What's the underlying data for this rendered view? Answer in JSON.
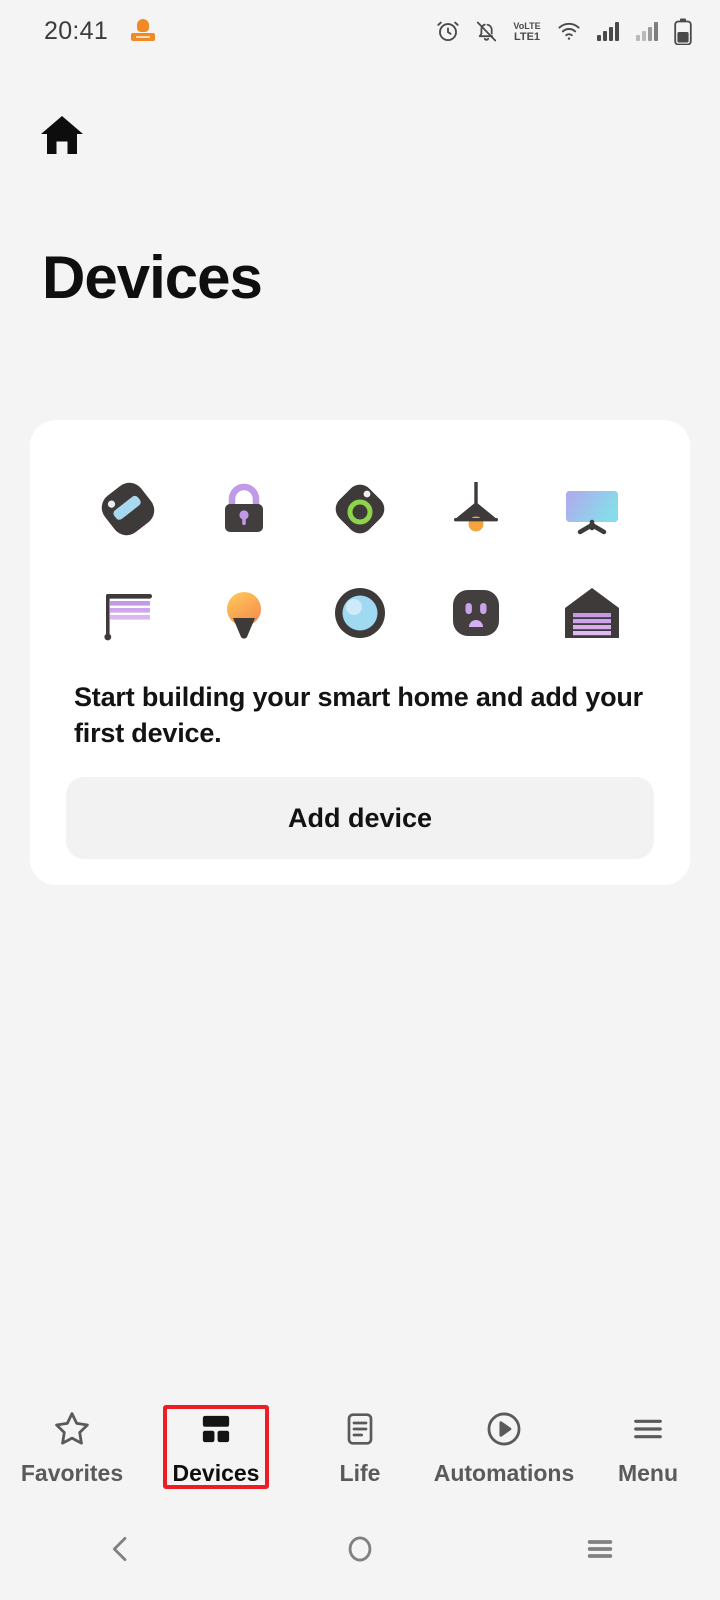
{
  "statusbar": {
    "time": "20:41",
    "left_icons": [
      {
        "name": "notification-badge-icon"
      }
    ],
    "right_icons": [
      {
        "name": "alarm-icon"
      },
      {
        "name": "notifications-muted-icon"
      },
      {
        "name": "volte-lte1-icon",
        "label_top": "VoLTE",
        "label_bottom": "LTE1"
      },
      {
        "name": "wifi-icon"
      },
      {
        "name": "signal-bars-sim1-icon"
      },
      {
        "name": "signal-bars-sim2-icon"
      },
      {
        "name": "battery-icon"
      }
    ]
  },
  "header": {
    "home_icon": "home-icon",
    "title": "Devices"
  },
  "empty_state": {
    "device_icons": [
      {
        "name": "robot-vacuum-icon",
        "label": "Robot vacuum"
      },
      {
        "name": "smart-lock-icon",
        "label": "Smart lock"
      },
      {
        "name": "sensor-icon",
        "label": "Sensor"
      },
      {
        "name": "pendant-light-icon",
        "label": "Pendant light"
      },
      {
        "name": "television-icon",
        "label": "Television"
      },
      {
        "name": "awning-icon",
        "label": "Awning"
      },
      {
        "name": "light-bulb-icon",
        "label": "Light bulb"
      },
      {
        "name": "motion-sensor-icon",
        "label": "Motion sensor"
      },
      {
        "name": "power-socket-icon",
        "label": "Power socket"
      },
      {
        "name": "garage-door-icon",
        "label": "Garage door"
      }
    ],
    "message": "Start building your smart home and add your first device.",
    "add_device_label": "Add device"
  },
  "tabbar": {
    "tabs": [
      {
        "label": "Favorites",
        "icon": "star-icon",
        "active": false
      },
      {
        "label": "Devices",
        "icon": "grid-icon",
        "active": true
      },
      {
        "label": "Life",
        "icon": "document-icon",
        "active": false
      },
      {
        "label": "Automations",
        "icon": "play-circle-icon",
        "active": false
      },
      {
        "label": "Menu",
        "icon": "hamburger-icon",
        "active": false
      }
    ],
    "highlight_color": "#ee1c25"
  },
  "navbar": {
    "back": "back-icon",
    "home": "home-circle-icon",
    "recents": "recents-icon"
  },
  "colors": {
    "page_background": "#f4f4f5",
    "card_background": "#ffffff",
    "button_background": "#f2f2f3",
    "text_primary": "#111111",
    "accent_orange": "#f08a26",
    "accent_purple": "#b98fe0",
    "accent_green": "#8ed44a",
    "accent_blue": "#8fd2ef",
    "highlight_red": "#ee1c25"
  }
}
